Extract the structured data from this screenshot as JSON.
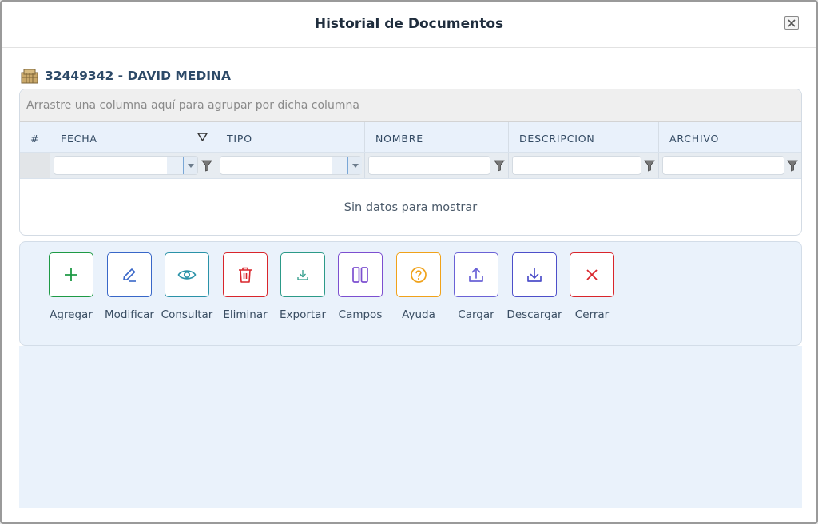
{
  "dialog": {
    "title": "Historial de Documentos"
  },
  "record": {
    "label": "32449342 - DAVID MEDINA"
  },
  "grid": {
    "group_panel_text": "Arrastre una columna aquí para agrupar por dicha columna",
    "columns": [
      "#",
      "FECHA",
      "TIPO",
      "NOMBRE",
      "DESCRIPCION",
      "ARCHIVO"
    ],
    "empty_text": "Sin datos para mostrar"
  },
  "toolbar": {
    "buttons": [
      {
        "label": "Agregar",
        "icon": "plus-icon",
        "color": "#1e9a45"
      },
      {
        "label": "Modificar",
        "icon": "pencil-icon",
        "color": "#3867c8"
      },
      {
        "label": "Consultar",
        "icon": "eye-icon",
        "color": "#2a92a8"
      },
      {
        "label": "Eliminar",
        "icon": "trash-icon",
        "color": "#d9252b"
      },
      {
        "label": "Exportar",
        "icon": "export-icon",
        "color": "#2c9a88"
      },
      {
        "label": "Campos",
        "icon": "columns-icon",
        "color": "#7c4fd0"
      },
      {
        "label": "Ayuda",
        "icon": "help-icon",
        "color": "#f0a21a"
      },
      {
        "label": "Cargar",
        "icon": "upload-icon",
        "color": "#6a62d6"
      },
      {
        "label": "Descargar",
        "icon": "download-icon",
        "color": "#4d4fc9"
      },
      {
        "label": "Cerrar",
        "icon": "close-x-icon",
        "color": "#d9252b"
      }
    ]
  }
}
